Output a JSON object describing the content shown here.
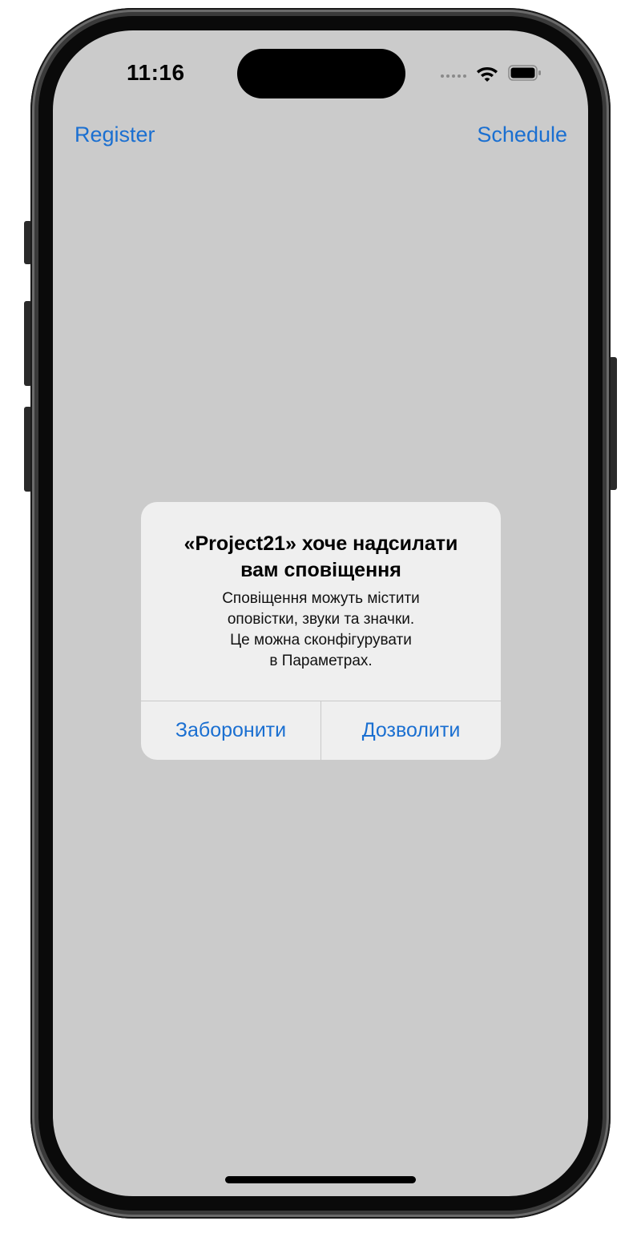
{
  "status_bar": {
    "time": "11:16",
    "icons": [
      "cellular-signal-icon",
      "wifi-icon",
      "battery-icon"
    ]
  },
  "nav_bar": {
    "left_label": "Register",
    "right_label": "Schedule"
  },
  "alert": {
    "title": "«Project21» хоче надсилати\nвам сповіщення",
    "message": "Сповіщення можуть містити\nоповістки, звуки та значки.\nЦе можна сконфігурувати\nв Параметрах.",
    "deny_label": "Заборонити",
    "allow_label": "Дозволити"
  },
  "colors": {
    "accent": "#1a6fd1",
    "screen_background": "#cbcbcb",
    "alert_background": "#efefef"
  }
}
